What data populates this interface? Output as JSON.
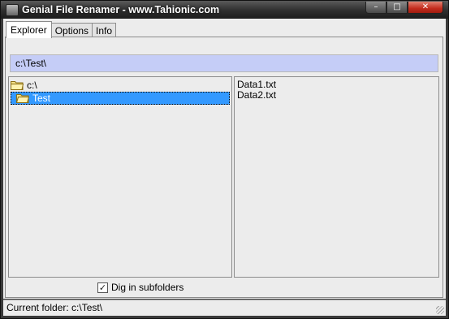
{
  "window": {
    "title": "Genial File Renamer  - www.Tahionic.com",
    "controls": {
      "minimize": "–",
      "maximize": "□",
      "close": "✕"
    }
  },
  "tabs": [
    {
      "label": "Explorer",
      "active": true
    },
    {
      "label": "Options",
      "active": false
    },
    {
      "label": "Info",
      "active": false
    }
  ],
  "path_field": {
    "value": "c:\\Test\\"
  },
  "folder_tree": [
    {
      "label": "c:\\",
      "selected": false
    },
    {
      "label": "Test",
      "selected": true
    }
  ],
  "files": [
    "Data1.txt",
    "Data2.txt"
  ],
  "options": {
    "dig_subfolders_label": "Dig in subfolders",
    "dig_subfolders_checked": true,
    "check_mark": "✓"
  },
  "statusbar": {
    "text": "Current folder: c:\\Test\\"
  },
  "colors": {
    "selection": "#3399ff",
    "path_bg": "#c5cdf7",
    "close_button": "#c42b1c"
  }
}
